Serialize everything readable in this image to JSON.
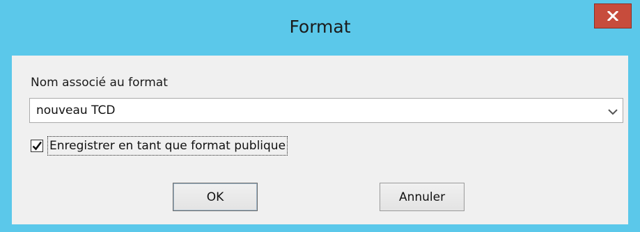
{
  "window": {
    "title": "Format",
    "close_label": "x",
    "close_icon": "close-icon"
  },
  "form": {
    "name_label": "Nom associé au format",
    "name_value": "nouveau TCD",
    "dropdown_icon": "chevron-down-icon",
    "public_checkbox_label": "Enregistrer en tant que format publique",
    "public_checked": true
  },
  "buttons": {
    "ok_label": "OK",
    "cancel_label": "Annuler"
  },
  "colors": {
    "titlebar": "#5bc8ea",
    "close_button": "#c74c3c",
    "client_background": "#f0f0f0"
  }
}
